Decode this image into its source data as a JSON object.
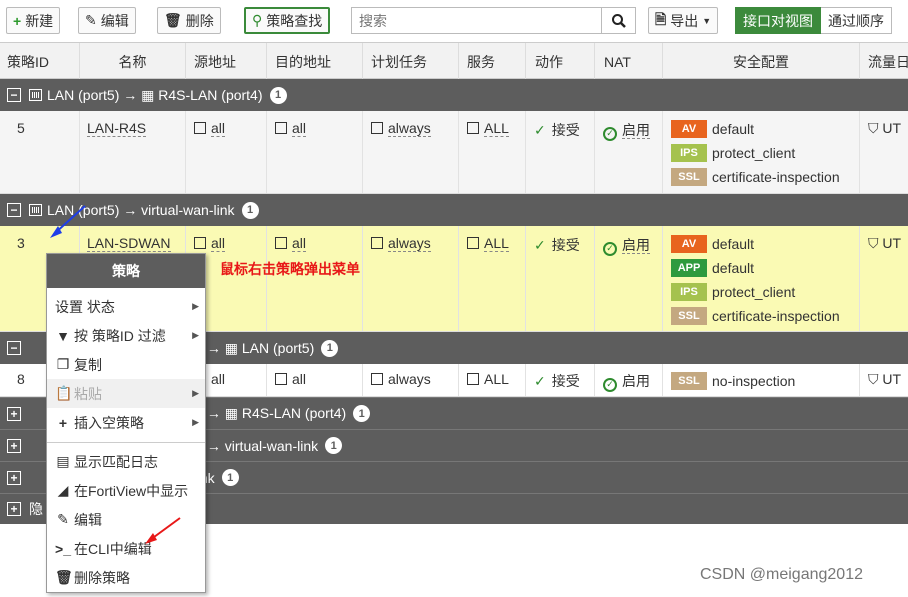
{
  "toolbar": {
    "new_label": "新建",
    "edit_label": "编辑",
    "delete_label": "删除",
    "policy_lookup_label": "策略查找",
    "search_placeholder": "搜索",
    "export_label": "导出",
    "view_interface_pair": "接口对视图",
    "view_sequence": "通过顺序"
  },
  "columns": [
    "策略ID",
    "名称",
    "源地址",
    "目的地址",
    "计划任务",
    "服务",
    "动作",
    "NAT",
    "安全配置",
    "流量日"
  ],
  "groups": [
    {
      "label": "LAN (port5) → ▦ R4S-LAN (port4)",
      "count": "1"
    },
    {
      "label": "LAN (port5) → virtual-wan-link",
      "count": "1"
    },
    {
      "label": "E) → ▦ LAN (port5)",
      "count": "1"
    },
    {
      "label": "E) → ▦ R4S-LAN (port4)",
      "count": "1"
    },
    {
      "label": "E) → virtual-wan-link",
      "count": "1"
    },
    {
      "label": "-link",
      "count": "1"
    },
    {
      "label": "隐",
      "count": ""
    }
  ],
  "rows": [
    {
      "id": "5",
      "name": "LAN-R4S",
      "src": "all",
      "dst": "all",
      "schedule": "always",
      "service": "ALL",
      "action": "接受",
      "nat": "启用",
      "log": "UT",
      "security": [
        {
          "tag": "AV",
          "value": "default"
        },
        {
          "tag": "IPS",
          "value": "protect_client"
        },
        {
          "tag": "SSL",
          "value": "certificate-inspection"
        }
      ]
    },
    {
      "id": "3",
      "name": "LAN-SDWAN",
      "src": "all",
      "dst": "all",
      "schedule": "always",
      "service": "ALL",
      "action": "接受",
      "nat": "启用",
      "log": "UT",
      "security": [
        {
          "tag": "AV",
          "value": "default"
        },
        {
          "tag": "APP",
          "value": "default"
        },
        {
          "tag": "IPS",
          "value": "protect_client"
        },
        {
          "tag": "SSL",
          "value": "certificate-inspection"
        }
      ]
    },
    {
      "id": "8",
      "name": "",
      "src": "all",
      "dst": "all",
      "schedule": "always",
      "service": "ALL",
      "action": "接受",
      "nat": "启用",
      "log": "UT",
      "security": [
        {
          "tag": "SSL",
          "value": "no-inspection"
        }
      ]
    }
  ],
  "context_menu": {
    "title": "策略",
    "items": [
      {
        "label": "设置 状态"
      },
      {
        "label": "按 策略ID 过滤"
      },
      {
        "label": "复制"
      },
      {
        "label": "粘贴"
      },
      {
        "label": "插入空策略"
      },
      {
        "label": "显示匹配日志"
      },
      {
        "label": "在FortiView中显示"
      },
      {
        "label": "编辑"
      },
      {
        "label": "在CLI中编辑"
      },
      {
        "label": "删除策略"
      }
    ]
  },
  "annotation": "鼠标右击策略弹出菜单",
  "watermark": "CSDN @meigang2012",
  "colors": {
    "accent": "#3c8a3c",
    "group_bg": "#5d5d5d",
    "highlight_row": "#fafab4",
    "annotation": "#e81818"
  }
}
